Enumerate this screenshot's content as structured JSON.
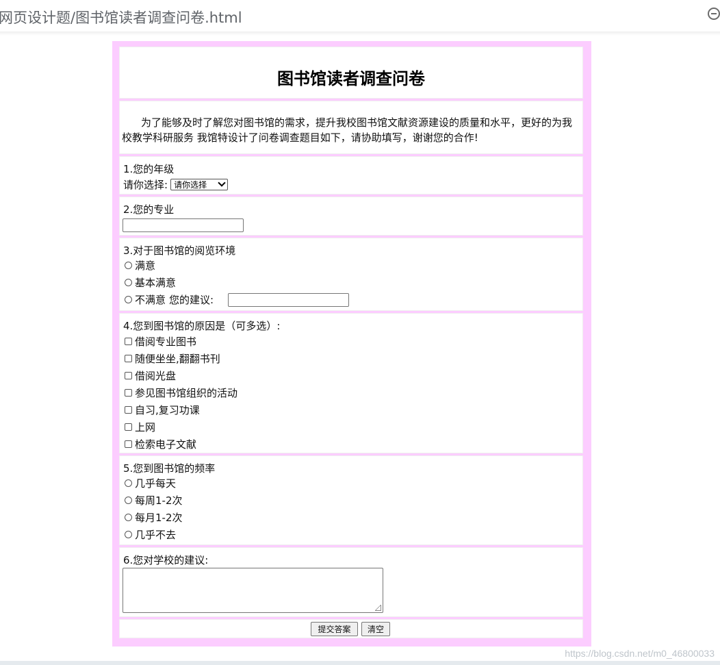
{
  "browser": {
    "title": "网页设计题/图书馆读者调查问卷.html"
  },
  "survey": {
    "title": "图书馆读者调查问卷",
    "intro": "为了能够及时了解您对图书馆的需求，提升我校图书馆文献资源建设的质量和水平，更好的为我校教学科研服务 我馆特设计了问卷调查题目如下，请协助填写，谢谢您的合作!",
    "q1": {
      "label": "1.您的年级",
      "prompt": "请你选择:",
      "selected": "请你选择"
    },
    "q2": {
      "label": "2.您的专业",
      "value": ""
    },
    "q3": {
      "label": "3.对于图书馆的阅览环境",
      "options": [
        "满意",
        "基本满意",
        "不满意"
      ],
      "suggestion_label": "您的建议:",
      "suggestion_value": ""
    },
    "q4": {
      "label": "4.您到图书馆的原因是（可多选）:",
      "options": [
        "借阅专业图书",
        "随便坐坐,翻翻书刊",
        "借阅光盘",
        "参见图书馆组织的活动",
        "自习,复习功课",
        "上网",
        "检索电子文献"
      ]
    },
    "q5": {
      "label": "5.您到图书馆的频率",
      "options": [
        "几乎每天",
        "每周1-2次",
        "每月1-2次",
        "几乎不去"
      ]
    },
    "q6": {
      "label": "6.您对学校的建议:",
      "value": ""
    },
    "buttons": {
      "submit": "提交答案",
      "clear": "清空"
    }
  },
  "watermark": "https://blog.csdn.net/m0_46800033",
  "colors": {
    "frame": "#fccdff",
    "background": "#ffffff",
    "bottom_bar": "#e5eaee"
  }
}
